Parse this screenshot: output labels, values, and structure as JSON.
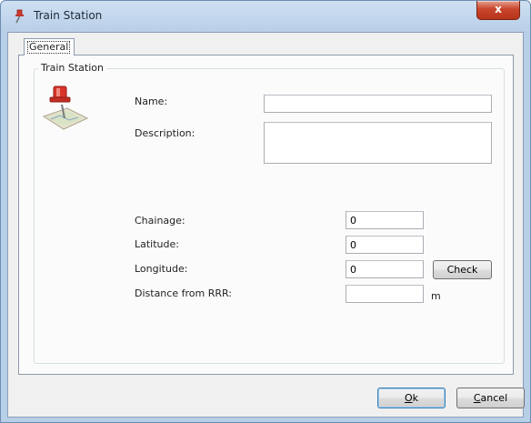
{
  "window": {
    "title": "Train Station",
    "close_glyph": "x",
    "icon": "pushpin-icon"
  },
  "tabs": [
    {
      "label": "General",
      "selected": true
    }
  ],
  "group": {
    "title": "Train Station",
    "icon": "pushpin-map-icon"
  },
  "form": {
    "name_label": "Name:",
    "name_value": "",
    "description_label": "Description:",
    "description_value": "",
    "chainage_label": "Chainage:",
    "chainage_value": "0",
    "latitude_label": "Latitude:",
    "latitude_value": "0",
    "longitude_label": "Longitude:",
    "longitude_value": "0",
    "check_label": "Check",
    "distance_label": "Distance from RRR:",
    "distance_value": "",
    "distance_unit": "m"
  },
  "footer": {
    "ok_mnemonic": "O",
    "ok_rest": "k",
    "cancel_mnemonic": "C",
    "cancel_rest": "ancel"
  },
  "colors": {
    "frame": "#b8cfe8",
    "close_button": "#c9462c",
    "default_button_border": "#3c7fb1"
  }
}
